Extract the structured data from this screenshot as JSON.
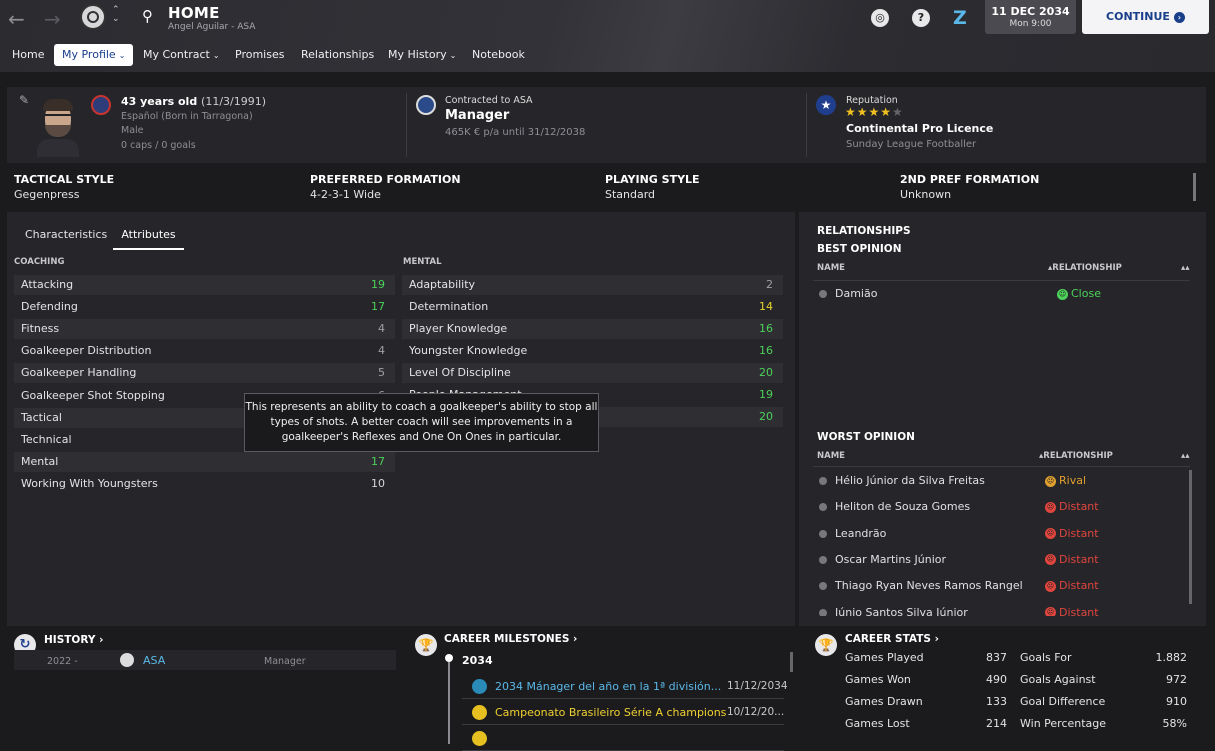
{
  "header": {
    "title": "HOME",
    "subtitle": "Angel Aguilar - ASA",
    "date": "11 DEC 2034",
    "day_time": "Mon 9:00",
    "continue_label": "CONTINUE"
  },
  "tabs": [
    {
      "label": "Home"
    },
    {
      "label": "My Profile"
    },
    {
      "label": "My Contract"
    },
    {
      "label": "Promises"
    },
    {
      "label": "Relationships"
    },
    {
      "label": "My History"
    },
    {
      "label": "Notebook"
    }
  ],
  "profile": {
    "age": "43 years old",
    "dob": "(11/3/1991)",
    "nationality": "Español (Born in Tarragona)",
    "gender": "Male",
    "caps": "0 caps / 0 goals",
    "contract_label": "Contracted to ASA",
    "role": "Manager",
    "wage": "465K € p/a until 31/12/2038",
    "rep_label": "Reputation",
    "stars": "★★★★",
    "licence": "Continental Pro Licence",
    "playing_past": "Sunday League Footballer"
  },
  "style": {
    "tactical_label": "TACTICAL STYLE",
    "tactical_value": "Gegenpress",
    "formation_label": "PREFERRED FORMATION",
    "formation_value": "4-2-3-1 Wide",
    "playing_label": "PLAYING STYLE",
    "playing_value": "Standard",
    "formation2_label": "2ND PREF FORMATION",
    "formation2_value": "Unknown"
  },
  "subtabs": [
    {
      "label": "Characteristics"
    },
    {
      "label": "Attributes"
    }
  ],
  "coaching": {
    "heading": "COACHING",
    "rows": [
      {
        "name": "Attacking",
        "value": "19"
      },
      {
        "name": "Defending",
        "value": "17"
      },
      {
        "name": "Fitness",
        "value": "4"
      },
      {
        "name": "Goalkeeper Distribution",
        "value": "4"
      },
      {
        "name": "Goalkeeper Handling",
        "value": "5"
      },
      {
        "name": "Goalkeeper Shot Stopping",
        "value": "6"
      },
      {
        "name": "Tactical",
        "value": ""
      },
      {
        "name": "Technical",
        "value": ""
      },
      {
        "name": "Mental",
        "value": "17"
      },
      {
        "name": "Working With Youngsters",
        "value": "10"
      }
    ]
  },
  "mental": {
    "heading": "MENTAL",
    "rows": [
      {
        "name": "Adaptability",
        "value": "2"
      },
      {
        "name": "Determination",
        "value": "14"
      },
      {
        "name": "Player Knowledge",
        "value": "16"
      },
      {
        "name": "Youngster Knowledge",
        "value": "16"
      },
      {
        "name": "Level Of Discipline",
        "value": "20"
      },
      {
        "name": "People Management",
        "value": "19"
      },
      {
        "name": "",
        "value": "20"
      }
    ]
  },
  "tooltip": "This represents an ability to coach a goalkeeper's ability to stop all types of shots. A better coach will see improvements in a goalkeeper's Reflexes and One On Ones in particular.",
  "relationships": {
    "heading": "RELATIONSHIPS",
    "best_heading": "BEST OPINION",
    "worst_heading": "WORST OPINION",
    "col_name": "NAME",
    "col_rel": "RELATIONSHIP",
    "best": [
      {
        "name": "Damião",
        "status": "Close"
      }
    ],
    "worst": [
      {
        "name": "Hélio Júnior da Silva Freitas",
        "status": "Rival"
      },
      {
        "name": "Heliton de Souza Gomes",
        "status": "Distant"
      },
      {
        "name": "Leandrão",
        "status": "Distant"
      },
      {
        "name": "Oscar Martins Júnior",
        "status": "Distant"
      },
      {
        "name": "Thiago Ryan Neves Ramos Rangel",
        "status": "Distant"
      },
      {
        "name": "Júnio Santos Silva Júnior",
        "status": "Distant"
      }
    ]
  },
  "history": {
    "heading": "HISTORY",
    "rows": [
      {
        "year": "2022 -",
        "club": "ASA",
        "role": "Manager"
      }
    ]
  },
  "milestones": {
    "heading": "CAREER MILESTONES",
    "year": "2034",
    "rows": [
      {
        "text": "2034 Mánager del año en la 1ª división...",
        "date": "11/12/2034"
      },
      {
        "text": "Campeonato Brasileiro Série A champions",
        "date": "10/12/20..."
      },
      {
        "text": "",
        "date": ""
      }
    ]
  },
  "career_stats": {
    "heading": "CAREER STATS",
    "left": [
      {
        "label": "Games Played",
        "value": "837"
      },
      {
        "label": "Games Won",
        "value": "490"
      },
      {
        "label": "Games Drawn",
        "value": "133"
      },
      {
        "label": "Games Lost",
        "value": "214"
      }
    ],
    "right": [
      {
        "label": "Goals For",
        "value": "1.882"
      },
      {
        "label": "Goals Against",
        "value": "972"
      },
      {
        "label": "Goal Difference",
        "value": "910"
      },
      {
        "label": "Win Percentage",
        "value": "58%"
      }
    ]
  },
  "colors": {
    "accent": "#1a3f8a",
    "good": "#4cd15a",
    "mid": "#e6d32a",
    "bad": "#e0453e",
    "rival": "#e0a030"
  }
}
